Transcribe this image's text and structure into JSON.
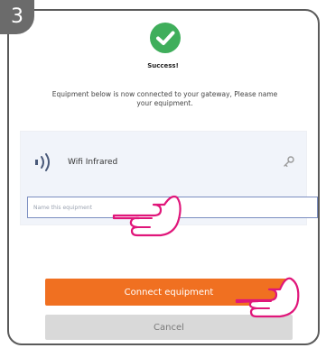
{
  "step": {
    "number": "3"
  },
  "status": {
    "title": "Success!",
    "color": "#3fae5b"
  },
  "description": "Equipment below is now connected to your gateway, Please name your equipment.",
  "equipment": {
    "name": "Wifi Infrared",
    "icon": "wifi-infrared-icon",
    "action_icon": "key-icon"
  },
  "name_input": {
    "placeholder": "Name this equipment",
    "value": ""
  },
  "buttons": {
    "connect_label": "Connect equipment",
    "connect_color": "#f07021",
    "cancel_label": "Cancel"
  },
  "annotations": {
    "pointer_icon": "pointing-hand-icon",
    "pointer_color": "#e0167a"
  }
}
